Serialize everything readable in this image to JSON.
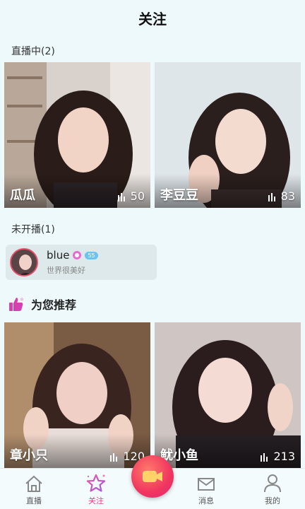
{
  "header": {
    "title": "关注"
  },
  "live_section": {
    "label": "直播中(2)",
    "cards": [
      {
        "name": "瓜瓜",
        "viewers": "50"
      },
      {
        "name": "李豆豆",
        "viewers": "83"
      }
    ]
  },
  "offline_section": {
    "label": "未开播(1)",
    "user": {
      "name": "blue",
      "level": "55",
      "signature": "世界很美好"
    }
  },
  "recommend_section": {
    "label": "为您推荐",
    "cards": [
      {
        "name": "章小只",
        "viewers": "120"
      },
      {
        "name": "鱿小鱼",
        "viewers": "213"
      }
    ]
  },
  "tabbar": {
    "items": [
      {
        "label": "直播",
        "icon": "home-icon"
      },
      {
        "label": "关注",
        "icon": "star-icon",
        "active": true
      },
      {
        "label": "消息",
        "icon": "mail-icon"
      },
      {
        "label": "我的",
        "icon": "user-icon"
      }
    ],
    "center_button_icon": "video-camera-icon"
  },
  "colors": {
    "background": "#eef9fb",
    "accent_pink": "#e0408a",
    "live_button": "#f0355f"
  }
}
